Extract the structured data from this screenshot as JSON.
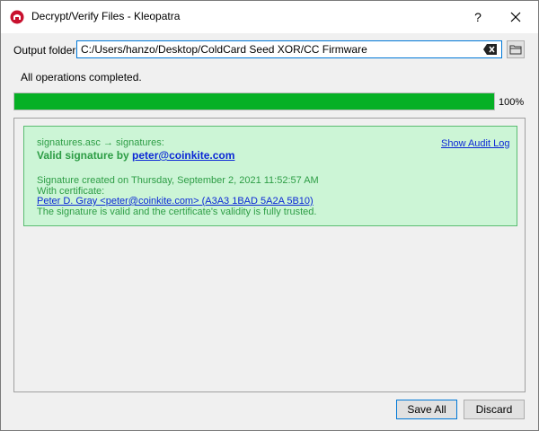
{
  "window": {
    "title": "Decrypt/Verify Files - Kleopatra",
    "help_label": "?"
  },
  "output": {
    "label": "Output folder:",
    "value": "C:/Users/hanzo/Desktop/ColdCard Seed XOR/CC Firmware"
  },
  "status": {
    "text": "All operations completed.",
    "progress_percent": 100,
    "progress_label": "100%"
  },
  "result": {
    "title": "signatures.asc → signatures:",
    "valid_prefix": "Valid signature by ",
    "signer_email": "peter@coinkite.com",
    "created": "Signature created on Thursday, September 2, 2021 11:52:57 AM",
    "with_certificate": "With certificate:",
    "certificate": "Peter D. Gray <peter@coinkite.com> (A3A3 1BAD 5A2A 5B10)",
    "validity": "The signature is valid and the certificate's validity is fully trusted.",
    "audit_link": "Show Audit Log"
  },
  "buttons": {
    "save_all": "Save All",
    "discard": "Discard"
  },
  "colors": {
    "progress": "#06b025",
    "result_bg": "#ccf5d6",
    "result_text": "#2d9d45",
    "link": "#0b28d6",
    "focus": "#0078d7"
  },
  "icons": {
    "app": "kleopatra-app-icon",
    "clear": "clear-text-icon",
    "browse": "folder-icon",
    "close": "close-icon"
  }
}
